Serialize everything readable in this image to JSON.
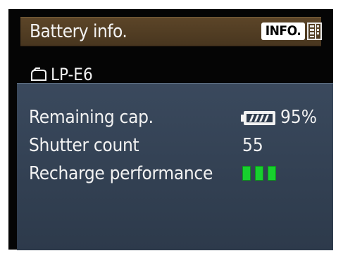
{
  "header": {
    "title": "Battery info.",
    "info_button": "INFO.",
    "icon": "grid-icon"
  },
  "battery": {
    "model": "LP-E6",
    "icon": "battery-outline-icon"
  },
  "rows": [
    {
      "label": "Remaining cap.",
      "value": "95%",
      "icon": "battery-level-icon"
    },
    {
      "label": "Shutter count",
      "value": "55"
    },
    {
      "label": "Recharge performance",
      "value": "",
      "bars_lit": 3,
      "bars_total": 3
    }
  ],
  "colors": {
    "header_bg": "#5c4528",
    "panel_bg": "#3a495d",
    "bar_green": "#17d02e",
    "text": "#f2f2f2"
  }
}
